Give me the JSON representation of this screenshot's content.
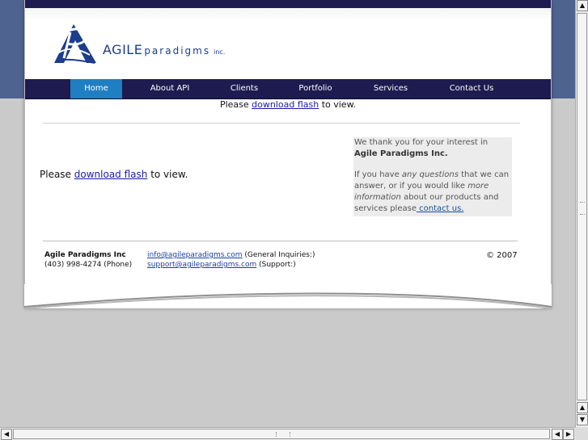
{
  "logo": {
    "name": "AGILE",
    "tagline": "paradigms",
    "suffix": "inc.",
    "icon": "ap-monogram-logo",
    "color": "#1b3d8c"
  },
  "nav": {
    "items": [
      {
        "label": "Home",
        "active": true
      },
      {
        "label": "About API",
        "active": false
      },
      {
        "label": "Clients",
        "active": false
      },
      {
        "label": "Portfolio",
        "active": false
      },
      {
        "label": "Services",
        "active": false
      },
      {
        "label": "Contact Us",
        "active": false
      }
    ],
    "bar_color": "#1d1b4f",
    "active_color": "#1f7fc2"
  },
  "flash_notice": {
    "before": "Please ",
    "link": "download flash",
    "after": " to view."
  },
  "thanks": {
    "line1_pre": "We thank you for your interest in ",
    "line1_bold": "Agile Paradigms Inc.",
    "line2_pre": "If you have ",
    "line2_em1": "any questions",
    "line2_mid": " that we can answer, or if you would like ",
    "line2_em2": "more information",
    "line2_post": " about our products and services please",
    "link": " contact us."
  },
  "footer": {
    "company": "Agile Paradigms Inc",
    "phone": "(403) 998-4274 (Phone)",
    "email_general": "info@agileparadigms.com",
    "email_general_note": " (General Inquiries:)",
    "email_support": "support@agileparadigms.com",
    "email_support_note": " (Support:)",
    "copyright": "© 2007"
  },
  "scrollbars": {
    "up_icon": "arrow-up-icon",
    "down_icon": "arrow-down-icon",
    "left_icon": "arrow-left-icon",
    "right_icon": "arrow-right-icon"
  }
}
